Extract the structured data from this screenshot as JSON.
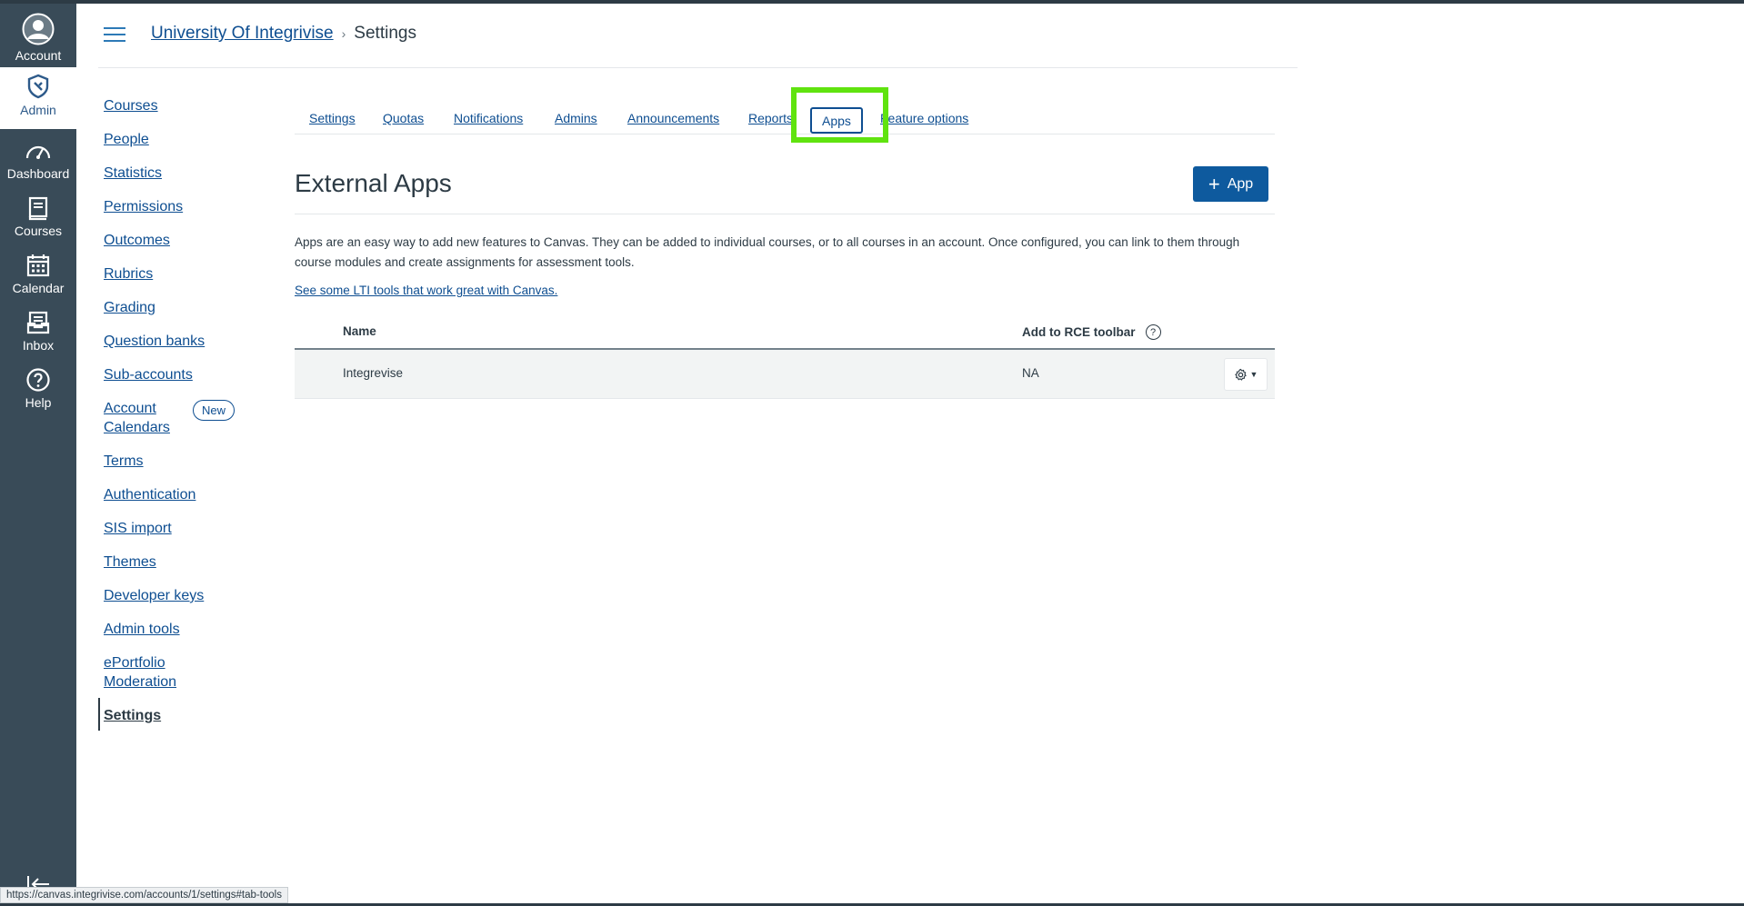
{
  "global_nav": {
    "items": [
      {
        "label": "Account",
        "icon": "account-avatar-icon"
      },
      {
        "label": "Admin",
        "icon": "admin-shield-icon"
      },
      {
        "label": "Dashboard",
        "icon": "dashboard-gauge-icon"
      },
      {
        "label": "Courses",
        "icon": "courses-book-icon"
      },
      {
        "label": "Calendar",
        "icon": "calendar-icon"
      },
      {
        "label": "Inbox",
        "icon": "inbox-icon"
      },
      {
        "label": "Help",
        "icon": "help-icon"
      }
    ],
    "active": "Admin"
  },
  "header": {
    "breadcrumb_account": "University Of Integrivise",
    "breadcrumb_separator": "›",
    "breadcrumb_current": "Settings"
  },
  "left_menu": {
    "items": [
      "Courses",
      "People",
      "Statistics",
      "Permissions",
      "Outcomes",
      "Rubrics",
      "Grading",
      "Question banks",
      "Sub-accounts",
      "Account Calendars",
      "Terms",
      "Authentication",
      "SIS import",
      "Themes",
      "Developer keys",
      "Admin tools",
      "ePortfolio Moderation",
      "Settings"
    ],
    "account_calendars_line1": "Account",
    "account_calendars_line2": "Calendars",
    "eportfolio_line1": "ePortfolio",
    "eportfolio_line2": "Moderation",
    "new_badge": "New",
    "active": "Settings"
  },
  "tabs": {
    "items": [
      "Settings",
      "Quotas",
      "Notifications",
      "Admins",
      "Announcements",
      "Reports",
      "Apps",
      "Feature options"
    ],
    "active": "Apps"
  },
  "main": {
    "title": "External Apps",
    "add_app_label": "App",
    "description": "Apps are an easy way to add new features to Canvas. They can be added to individual courses, or to all courses in an account. Once configured, you can link to them through course modules and create assignments for assessment tools.",
    "lti_link": "See some LTI tools that work great with Canvas.",
    "table": {
      "columns": [
        "Name",
        "Add to RCE toolbar"
      ],
      "help_glyph": "?",
      "rows": [
        {
          "name": "Integrevise",
          "rce": "NA"
        }
      ]
    }
  },
  "status_bar": {
    "url": "https://canvas.integrivise.com/accounts/1/settings#tab-tools"
  },
  "colors": {
    "nav_bg": "#394b58",
    "link": "#0e4e91",
    "primary_button": "#0e5a9e",
    "highlight_box": "#60e30f"
  }
}
